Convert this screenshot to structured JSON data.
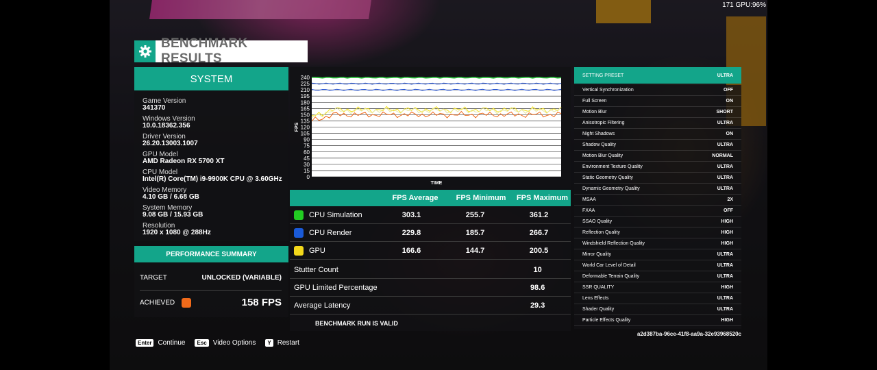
{
  "hud": {
    "text": "171 GPU:96%"
  },
  "title": "BENCHMARK RESULTS",
  "system": {
    "heading": "SYSTEM",
    "items": [
      {
        "label": "Game Version",
        "value": "341370"
      },
      {
        "label": "Windows Version",
        "value": "10.0.18362.356"
      },
      {
        "label": "Driver Version",
        "value": "26.20.13003.1007"
      },
      {
        "label": "GPU Model",
        "value": "AMD Radeon RX 5700 XT"
      },
      {
        "label": "CPU Model",
        "value": "Intel(R) Core(TM) i9-9900K CPU @ 3.60GHz"
      },
      {
        "label": "Video Memory",
        "value": "4.10 GB / 6.68 GB"
      },
      {
        "label": "System Memory",
        "value": "9.08 GB / 15.93 GB"
      },
      {
        "label": "Resolution",
        "value": "1920 x 1080 @ 288Hz"
      }
    ]
  },
  "performance": {
    "heading": "PERFORMANCE SUMMARY",
    "target_label": "TARGET",
    "target_value": "UNLOCKED (VARIABLE)",
    "achieved_label": "ACHIEVED",
    "achieved_value": "158 FPS",
    "achieved_color": "#f06a1a"
  },
  "chart_data": {
    "type": "line",
    "xlabel": "TIME",
    "ylabel": "FPS",
    "ylim": [
      0,
      240
    ],
    "yticks": [
      "240",
      "225",
      "210",
      "195",
      "180",
      "165",
      "150",
      "135",
      "120",
      "105",
      "90",
      "75",
      "60",
      "45",
      "30",
      "15",
      "0"
    ],
    "series": [
      {
        "color": "#2ecc40",
        "level": 240
      },
      {
        "color": "#1e4fd8",
        "level": 225
      },
      {
        "color": "#1e4fd8",
        "level": 210
      },
      {
        "color": "#f5e21a",
        "level": 162
      },
      {
        "color": "#e8e8a0",
        "level": 160
      },
      {
        "color": "#f06a1a",
        "level": 150
      }
    ]
  },
  "fps_table": {
    "headers": [
      "FPS Average",
      "FPS Minimum",
      "FPS Maximum"
    ],
    "rows": [
      {
        "name": "CPU Simulation",
        "color": "#22cc22",
        "avg": "303.1",
        "min": "255.7",
        "max": "361.2"
      },
      {
        "name": "CPU Render",
        "color": "#1a5ad8",
        "avg": "229.8",
        "min": "185.7",
        "max": "266.7"
      },
      {
        "name": "GPU",
        "color": "#f3d81b",
        "avg": "166.6",
        "min": "144.7",
        "max": "200.5"
      }
    ],
    "stats": [
      {
        "label": "Stutter Count",
        "value": "10"
      },
      {
        "label": "GPU Limited Percentage",
        "value": "98.6"
      },
      {
        "label": "Average Latency",
        "value": "29.3"
      }
    ],
    "valid_text": "BENCHMARK RUN IS VALID"
  },
  "settings": {
    "preset_label": "SETTING PRESET",
    "preset_value": "ULTRA",
    "rows": [
      {
        "label": "Vertical Synchronization",
        "value": "OFF"
      },
      {
        "label": "Full Screen",
        "value": "ON"
      },
      {
        "label": "Motion Blur",
        "value": "SHORT"
      },
      {
        "label": "Anisotropic Filtering",
        "value": "ULTRA"
      },
      {
        "label": "Night Shadows",
        "value": "ON"
      },
      {
        "label": "Shadow Quality",
        "value": "ULTRA"
      },
      {
        "label": "Motion Blur Quality",
        "value": "NORMAL"
      },
      {
        "label": "Environment Texture Quality",
        "value": "ULTRA"
      },
      {
        "label": "Static Geometry Quality",
        "value": "ULTRA"
      },
      {
        "label": "Dynamic Geometry Quality",
        "value": "ULTRA"
      },
      {
        "label": "MSAA",
        "value": "2X"
      },
      {
        "label": "FXAA",
        "value": "OFF"
      },
      {
        "label": "SSAO Quality",
        "value": "HIGH"
      },
      {
        "label": "Reflection Quality",
        "value": "HIGH"
      },
      {
        "label": "Windshield Reflection Quality",
        "value": "HIGH"
      },
      {
        "label": "Mirror Quality",
        "value": "ULTRA"
      },
      {
        "label": "World Car Level of Detail",
        "value": "ULTRA"
      },
      {
        "label": "Deformable Terrain Quality",
        "value": "ULTRA"
      },
      {
        "label": "SSR QUALITY",
        "value": "HIGH"
      },
      {
        "label": "Lens Effects",
        "value": "ULTRA"
      },
      {
        "label": "Shader Quality",
        "value": "ULTRA"
      },
      {
        "label": "Particle Effects Quality",
        "value": "HIGH"
      }
    ]
  },
  "hash": "a2d387ba-96ce-41f8-aa9a-32e93968520c",
  "footer": {
    "items": [
      {
        "key": "Enter",
        "label": "Continue"
      },
      {
        "key": "Esc",
        "label": "Video Options"
      },
      {
        "key": "Y",
        "label": "Restart"
      }
    ]
  },
  "colors": {
    "accent": "#13a58a"
  }
}
